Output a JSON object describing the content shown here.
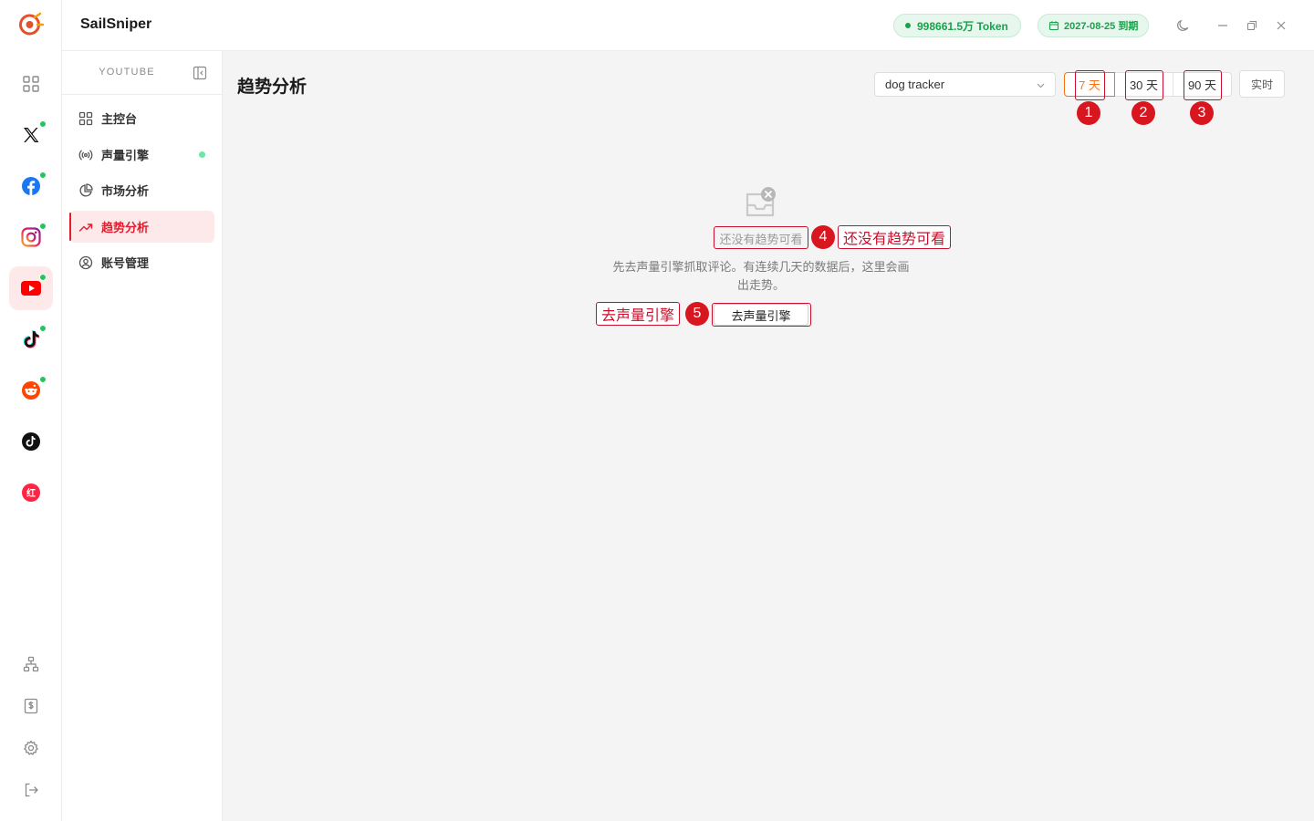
{
  "app": {
    "name": "SailSniper"
  },
  "header": {
    "token_label": "998661.5万 Token",
    "expiry_label": "2027-08-25 到期"
  },
  "rail": {
    "items": [
      {
        "name": "dashboard-grid-icon",
        "active": false,
        "online": false
      },
      {
        "name": "x-icon",
        "active": false,
        "online": true
      },
      {
        "name": "facebook-icon",
        "active": false,
        "online": true
      },
      {
        "name": "instagram-icon",
        "active": false,
        "online": true
      },
      {
        "name": "youtube-icon",
        "active": true,
        "online": true
      },
      {
        "name": "tiktok-icon",
        "active": false,
        "online": true
      },
      {
        "name": "reddit-icon",
        "active": false,
        "online": true
      },
      {
        "name": "tiktok-dark-icon",
        "active": false,
        "online": false
      },
      {
        "name": "xiaohongshu-icon",
        "active": false,
        "online": false
      }
    ],
    "xiaohongshu_glyph": "红"
  },
  "sidebar": {
    "section_title": "YOUTUBE",
    "items": [
      {
        "label": "主控台",
        "icon": "dashboard-icon"
      },
      {
        "label": "声量引擎",
        "icon": "broadcast-icon"
      },
      {
        "label": "市场分析",
        "icon": "pie-chart-icon"
      },
      {
        "label": "趋势分析",
        "icon": "trend-icon"
      },
      {
        "label": "账号管理",
        "icon": "user-circle-icon"
      }
    ]
  },
  "main": {
    "title": "趋势分析",
    "project_select": {
      "value": "dog tracker"
    },
    "ranges": [
      "7 天",
      "30 天",
      "90 天"
    ],
    "selected_range": "7 天",
    "realtime_label": "实时",
    "empty": {
      "title": "还没有趋势可看",
      "description": "先去声量引擎抓取评论。有连续几天的数据后，这里会画出走势。",
      "action_label": "去声量引擎"
    }
  },
  "annotations": {
    "badges": [
      "1",
      "2",
      "3",
      "4",
      "5"
    ],
    "labels": [
      "还没有趋势可看",
      "去声量引擎"
    ]
  },
  "colors": {
    "accent": "#e11d2e",
    "selected_range": "#f97316",
    "success": "#16a34a",
    "annotation": "#c8102e"
  }
}
